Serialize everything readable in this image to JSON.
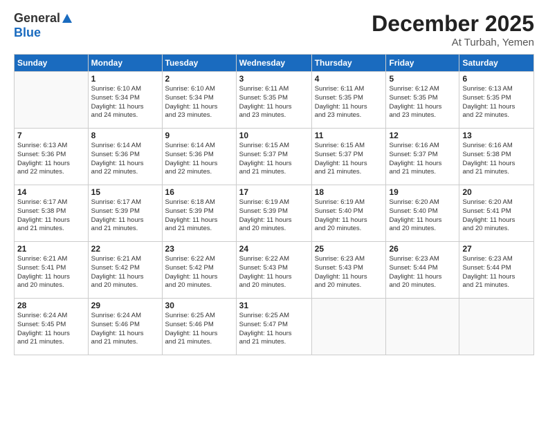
{
  "header": {
    "logo_general": "General",
    "logo_blue": "Blue",
    "month_title": "December 2025",
    "location": "At Turbah, Yemen"
  },
  "days_of_week": [
    "Sunday",
    "Monday",
    "Tuesday",
    "Wednesday",
    "Thursday",
    "Friday",
    "Saturday"
  ],
  "weeks": [
    [
      {
        "day": "",
        "info": ""
      },
      {
        "day": "1",
        "info": "Sunrise: 6:10 AM\nSunset: 5:34 PM\nDaylight: 11 hours\nand 24 minutes."
      },
      {
        "day": "2",
        "info": "Sunrise: 6:10 AM\nSunset: 5:34 PM\nDaylight: 11 hours\nand 23 minutes."
      },
      {
        "day": "3",
        "info": "Sunrise: 6:11 AM\nSunset: 5:35 PM\nDaylight: 11 hours\nand 23 minutes."
      },
      {
        "day": "4",
        "info": "Sunrise: 6:11 AM\nSunset: 5:35 PM\nDaylight: 11 hours\nand 23 minutes."
      },
      {
        "day": "5",
        "info": "Sunrise: 6:12 AM\nSunset: 5:35 PM\nDaylight: 11 hours\nand 23 minutes."
      },
      {
        "day": "6",
        "info": "Sunrise: 6:13 AM\nSunset: 5:35 PM\nDaylight: 11 hours\nand 22 minutes."
      }
    ],
    [
      {
        "day": "7",
        "info": "Sunrise: 6:13 AM\nSunset: 5:36 PM\nDaylight: 11 hours\nand 22 minutes."
      },
      {
        "day": "8",
        "info": "Sunrise: 6:14 AM\nSunset: 5:36 PM\nDaylight: 11 hours\nand 22 minutes."
      },
      {
        "day": "9",
        "info": "Sunrise: 6:14 AM\nSunset: 5:36 PM\nDaylight: 11 hours\nand 22 minutes."
      },
      {
        "day": "10",
        "info": "Sunrise: 6:15 AM\nSunset: 5:37 PM\nDaylight: 11 hours\nand 21 minutes."
      },
      {
        "day": "11",
        "info": "Sunrise: 6:15 AM\nSunset: 5:37 PM\nDaylight: 11 hours\nand 21 minutes."
      },
      {
        "day": "12",
        "info": "Sunrise: 6:16 AM\nSunset: 5:37 PM\nDaylight: 11 hours\nand 21 minutes."
      },
      {
        "day": "13",
        "info": "Sunrise: 6:16 AM\nSunset: 5:38 PM\nDaylight: 11 hours\nand 21 minutes."
      }
    ],
    [
      {
        "day": "14",
        "info": "Sunrise: 6:17 AM\nSunset: 5:38 PM\nDaylight: 11 hours\nand 21 minutes."
      },
      {
        "day": "15",
        "info": "Sunrise: 6:17 AM\nSunset: 5:39 PM\nDaylight: 11 hours\nand 21 minutes."
      },
      {
        "day": "16",
        "info": "Sunrise: 6:18 AM\nSunset: 5:39 PM\nDaylight: 11 hours\nand 21 minutes."
      },
      {
        "day": "17",
        "info": "Sunrise: 6:19 AM\nSunset: 5:39 PM\nDaylight: 11 hours\nand 20 minutes."
      },
      {
        "day": "18",
        "info": "Sunrise: 6:19 AM\nSunset: 5:40 PM\nDaylight: 11 hours\nand 20 minutes."
      },
      {
        "day": "19",
        "info": "Sunrise: 6:20 AM\nSunset: 5:40 PM\nDaylight: 11 hours\nand 20 minutes."
      },
      {
        "day": "20",
        "info": "Sunrise: 6:20 AM\nSunset: 5:41 PM\nDaylight: 11 hours\nand 20 minutes."
      }
    ],
    [
      {
        "day": "21",
        "info": "Sunrise: 6:21 AM\nSunset: 5:41 PM\nDaylight: 11 hours\nand 20 minutes."
      },
      {
        "day": "22",
        "info": "Sunrise: 6:21 AM\nSunset: 5:42 PM\nDaylight: 11 hours\nand 20 minutes."
      },
      {
        "day": "23",
        "info": "Sunrise: 6:22 AM\nSunset: 5:42 PM\nDaylight: 11 hours\nand 20 minutes."
      },
      {
        "day": "24",
        "info": "Sunrise: 6:22 AM\nSunset: 5:43 PM\nDaylight: 11 hours\nand 20 minutes."
      },
      {
        "day": "25",
        "info": "Sunrise: 6:23 AM\nSunset: 5:43 PM\nDaylight: 11 hours\nand 20 minutes."
      },
      {
        "day": "26",
        "info": "Sunrise: 6:23 AM\nSunset: 5:44 PM\nDaylight: 11 hours\nand 20 minutes."
      },
      {
        "day": "27",
        "info": "Sunrise: 6:23 AM\nSunset: 5:44 PM\nDaylight: 11 hours\nand 21 minutes."
      }
    ],
    [
      {
        "day": "28",
        "info": "Sunrise: 6:24 AM\nSunset: 5:45 PM\nDaylight: 11 hours\nand 21 minutes."
      },
      {
        "day": "29",
        "info": "Sunrise: 6:24 AM\nSunset: 5:46 PM\nDaylight: 11 hours\nand 21 minutes."
      },
      {
        "day": "30",
        "info": "Sunrise: 6:25 AM\nSunset: 5:46 PM\nDaylight: 11 hours\nand 21 minutes."
      },
      {
        "day": "31",
        "info": "Sunrise: 6:25 AM\nSunset: 5:47 PM\nDaylight: 11 hours\nand 21 minutes."
      },
      {
        "day": "",
        "info": ""
      },
      {
        "day": "",
        "info": ""
      },
      {
        "day": "",
        "info": ""
      }
    ]
  ]
}
